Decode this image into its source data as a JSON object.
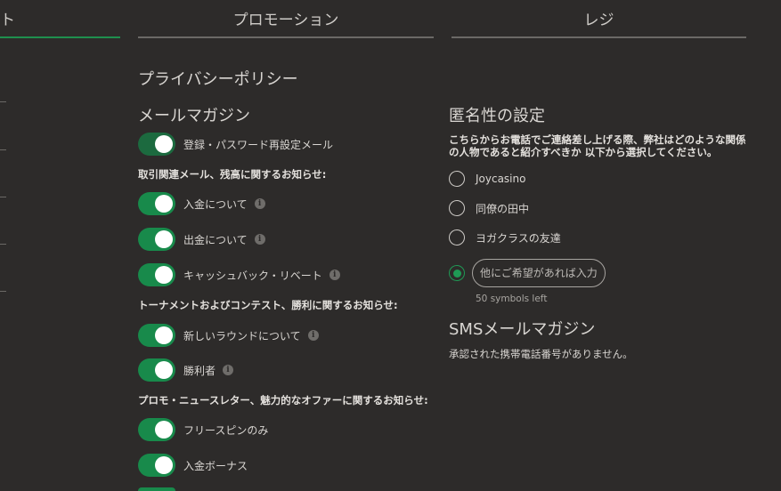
{
  "tabs": [
    {
      "label": "ト"
    },
    {
      "label": "プロモーション"
    },
    {
      "label": "レジ"
    }
  ],
  "privacy_policy_link": "プライバシーポリシー",
  "newsletter": {
    "title": "メールマガジン",
    "top_toggle": {
      "label": "登録・パスワード再設定メール",
      "on": true
    },
    "groups": [
      {
        "title": "取引関連メール、残高に関するお知らせ:",
        "items": [
          {
            "label": "入金について",
            "on": true
          },
          {
            "label": "出金について",
            "on": true
          },
          {
            "label": "キャッシュバック・リベート",
            "on": true
          }
        ]
      },
      {
        "title": "トーナメントおよびコンテスト、勝利に関するお知らせ:",
        "items": [
          {
            "label": "新しいラウンドについて",
            "on": true
          },
          {
            "label": "勝利者",
            "on": true
          }
        ]
      },
      {
        "title": "プロモ・ニュースレター、魅力的なオファーに関するお知らせ:",
        "items": [
          {
            "label": "フリースピンのみ",
            "on": true
          },
          {
            "label": "入金ボーナス",
            "on": true
          }
        ]
      }
    ]
  },
  "anonymity": {
    "title": "匿名性の設定",
    "description": "こちらからお電話でご連絡差し上げる際、弊社はどのような関係の人物であると紹介すべきか 以下から選択してください。",
    "options": [
      {
        "label": "Joycasino",
        "selected": false
      },
      {
        "label": "同僚の田中",
        "selected": false
      },
      {
        "label": "ヨガクラスの友達",
        "selected": false
      }
    ],
    "custom": {
      "placeholder": "他にご希望があれば入力して",
      "value": "",
      "selected": true
    },
    "symbols_left": "50 symbols left"
  },
  "sms": {
    "title": "SMSメールマガジン",
    "message": "承認された携帯電話番号がありません。"
  },
  "colors": {
    "background": "#2d2b2a",
    "accent": "#188a4b",
    "text": "#d9d6d2"
  }
}
